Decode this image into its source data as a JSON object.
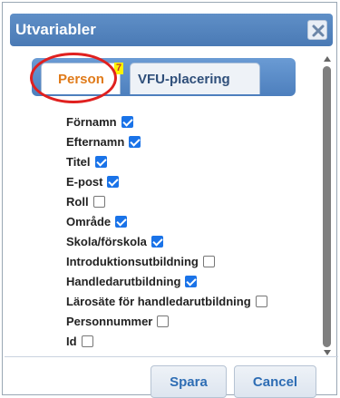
{
  "dialog": {
    "title": "Utvariabler"
  },
  "tabs": [
    {
      "label": "Person",
      "badge": "7",
      "active": true
    },
    {
      "label": "VFU-placering",
      "active": false
    }
  ],
  "fields": [
    {
      "label": "Förnamn",
      "checked": true
    },
    {
      "label": "Efternamn",
      "checked": true
    },
    {
      "label": "Titel",
      "checked": true
    },
    {
      "label": "E-post",
      "checked": true
    },
    {
      "label": "Roll",
      "checked": false
    },
    {
      "label": "Område",
      "checked": true
    },
    {
      "label": "Skola/förskola",
      "checked": true
    },
    {
      "label": "Introduktionsutbildning",
      "checked": false
    },
    {
      "label": "Handledarutbildning",
      "checked": true
    },
    {
      "label": "Lärosäte för handledarutbildning",
      "checked": false
    },
    {
      "label": "Personnummer",
      "checked": false
    },
    {
      "label": "Id",
      "checked": false
    }
  ],
  "footer": {
    "save_label": "Spara",
    "cancel_label": "Cancel"
  },
  "colors": {
    "titlebar": "#4a7ab5",
    "active_tab_text": "#e07b1a",
    "checkbox_checked": "#1a73e8",
    "highlight_circle": "#e0201f",
    "badge_bg": "#fff200"
  }
}
